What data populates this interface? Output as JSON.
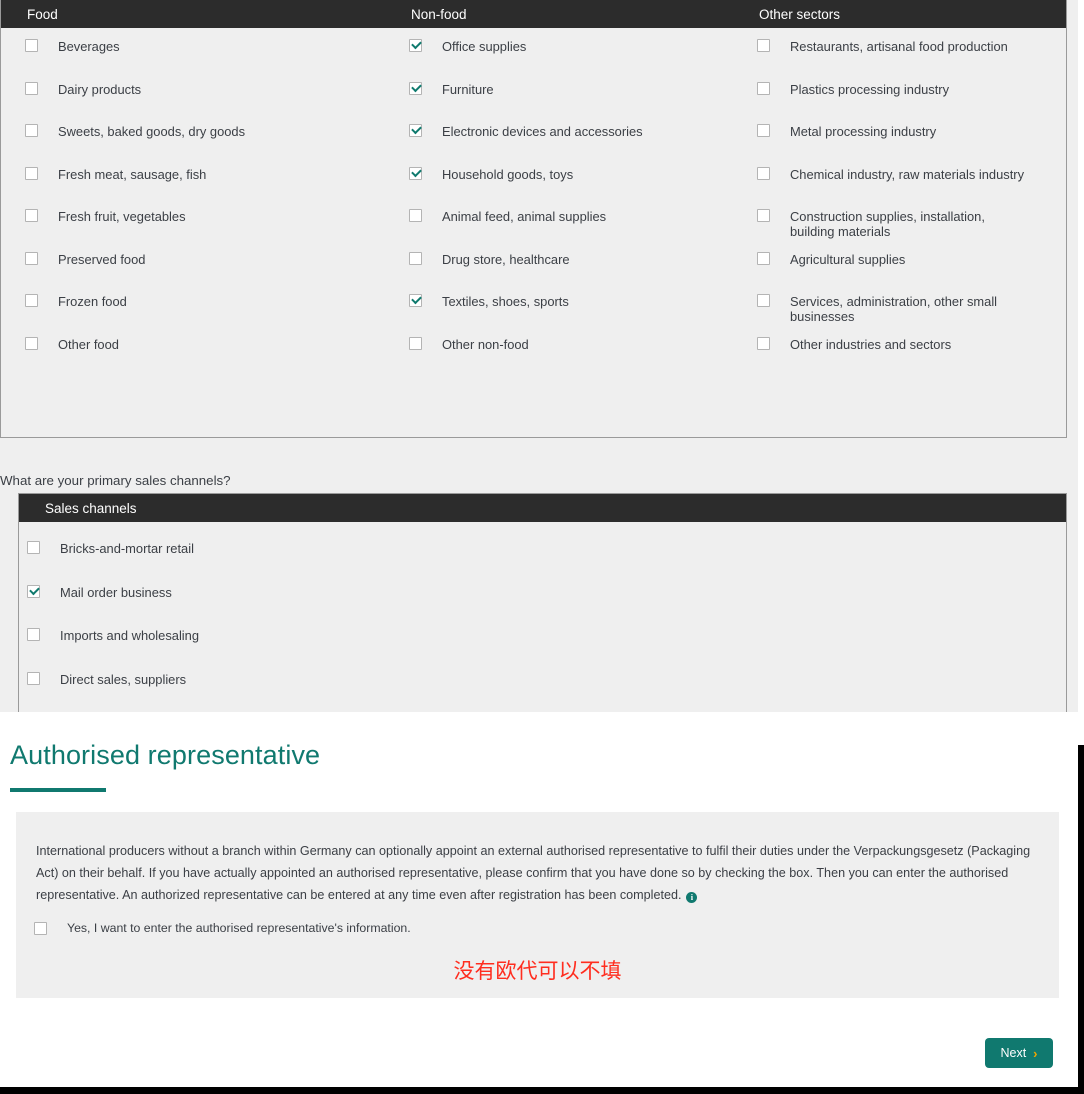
{
  "sectors_table": {
    "columns": [
      {
        "header": "Food",
        "name": "food",
        "items": [
          {
            "label": "Beverages",
            "checked": false
          },
          {
            "label": "Dairy products",
            "checked": false
          },
          {
            "label": "Sweets, baked goods, dry goods",
            "checked": false
          },
          {
            "label": "Fresh meat, sausage, fish",
            "checked": false
          },
          {
            "label": "Fresh fruit, vegetables",
            "checked": false
          },
          {
            "label": "Preserved food",
            "checked": false
          },
          {
            "label": "Frozen food",
            "checked": false
          },
          {
            "label": "Other food",
            "checked": false
          }
        ]
      },
      {
        "header": "Non-food",
        "name": "non-food",
        "items": [
          {
            "label": "Office supplies",
            "checked": true
          },
          {
            "label": "Furniture",
            "checked": true
          },
          {
            "label": "Electronic devices and accessories",
            "checked": true
          },
          {
            "label": "Household goods, toys",
            "checked": true
          },
          {
            "label": "Animal feed, animal supplies",
            "checked": false
          },
          {
            "label": "Drug store, healthcare",
            "checked": false
          },
          {
            "label": "Textiles, shoes, sports",
            "checked": true
          },
          {
            "label": "Other non-food",
            "checked": false
          }
        ]
      },
      {
        "header": "Other sectors",
        "name": "other-sectors",
        "items": [
          {
            "label": "Restaurants, artisanal food production",
            "checked": false
          },
          {
            "label": "Plastics processing industry",
            "checked": false
          },
          {
            "label": "Metal processing industry",
            "checked": false
          },
          {
            "label": "Chemical industry, raw materials industry",
            "checked": false
          },
          {
            "label": "Construction supplies, installation, building materials",
            "checked": false
          },
          {
            "label": "Agricultural supplies",
            "checked": false
          },
          {
            "label": "Services, administration, other small businesses",
            "checked": false
          },
          {
            "label": "Other industries and sectors",
            "checked": false
          }
        ]
      }
    ]
  },
  "sales_channels": {
    "question": "What are your primary sales channels?",
    "header": "Sales channels",
    "items": [
      {
        "label": "Bricks-and-mortar retail",
        "checked": false
      },
      {
        "label": "Mail order business",
        "checked": true
      },
      {
        "label": "Imports and wholesaling",
        "checked": false
      },
      {
        "label": "Direct sales, suppliers",
        "checked": false
      }
    ]
  },
  "authorised_representative": {
    "title": "Authorised representative",
    "paragraph": "International producers without a branch within Germany can optionally appoint an external authorised representative to fulfil their duties under the Verpackungsgesetz (Packaging Act) on their behalf. If you have actually appointed an authorised representative, please confirm that you have done so by checking the box. Then you can enter the authorised representative. An authorized representative can be entered at any time even after registration has been completed.",
    "info_glyph": "i",
    "confirm_checkbox": {
      "label": "Yes, I want to enter the authorised representative's information.",
      "checked": false
    },
    "annotation_note": "没有欧代可以不填"
  },
  "footer": {
    "next_label": "Next",
    "next_chevron": "›"
  },
  "colors": {
    "accent_teal": "#10796f",
    "header_dark": "#2c2c2c",
    "panel_grey": "#efefef",
    "annotation_red": "#ff2d1f",
    "chevron_orange": "#f0a500"
  }
}
